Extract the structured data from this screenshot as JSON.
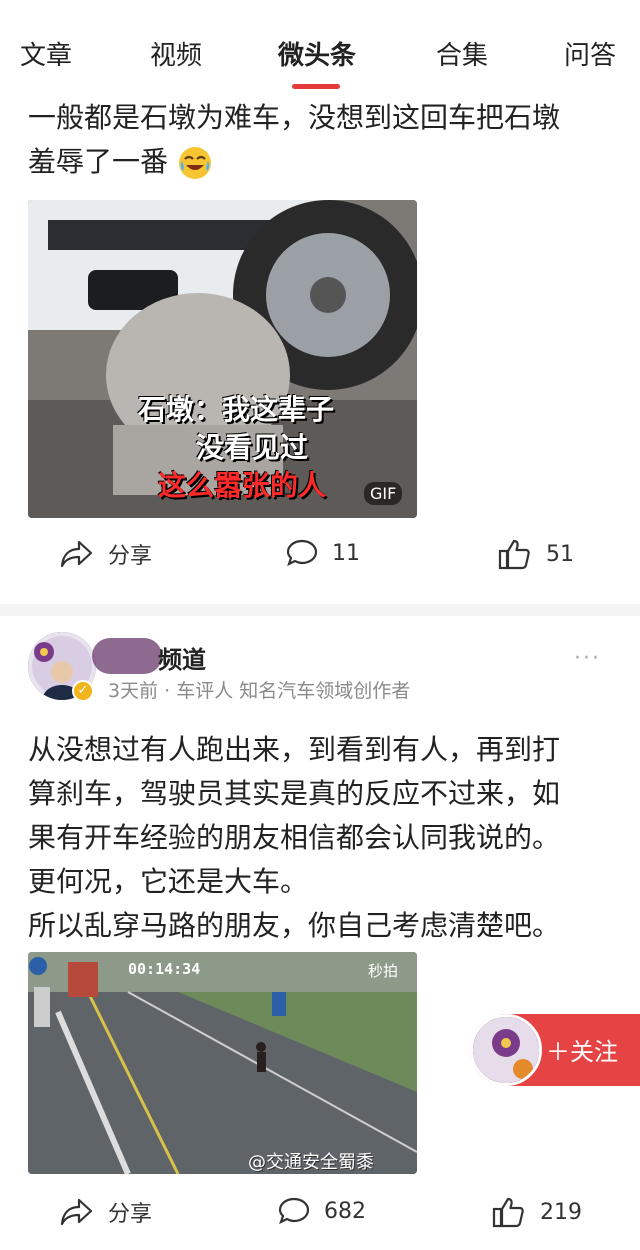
{
  "tabs": [
    "文章",
    "视频",
    "微头条",
    "合集",
    "问答"
  ],
  "active_tab": "微头条",
  "post1": {
    "text_line1": "一般都是石墩为难车，没想到这回车把石墩",
    "text_line2": "羞辱了一番",
    "image_caption_line1": "石墩：我这辈子",
    "image_caption_line2": "没看见过",
    "image_caption_line3": "这么嚣张的人",
    "gif_badge": "GIF",
    "share_label": "分享",
    "comments": "11",
    "likes": "51"
  },
  "post2": {
    "author": "频道",
    "time": "3天前",
    "category": "车评人",
    "title": "知名汽车领域创作者",
    "more": "···",
    "text": [
      "从没想过有人跑出来，到看到有人，再到打",
      "算刹车，驾驶员其实是真的反应不过来，如",
      "果有开车经验的朋友相信都会认同我说的。",
      "更何况，它还是大车。",
      "所以乱穿马路的朋友，你自己考虑清楚吧。"
    ],
    "video_timestamp": "00:14:34",
    "video_logo": "秒拍",
    "video_watermark": "@交通安全蜀黍",
    "share_label": "分享",
    "comments": "682",
    "likes": "219"
  },
  "follow": {
    "label": "＋关注"
  },
  "colors": {
    "accent": "#e64444",
    "tab_indicator": "#e63a3a",
    "meta": "#8a8a8a"
  }
}
